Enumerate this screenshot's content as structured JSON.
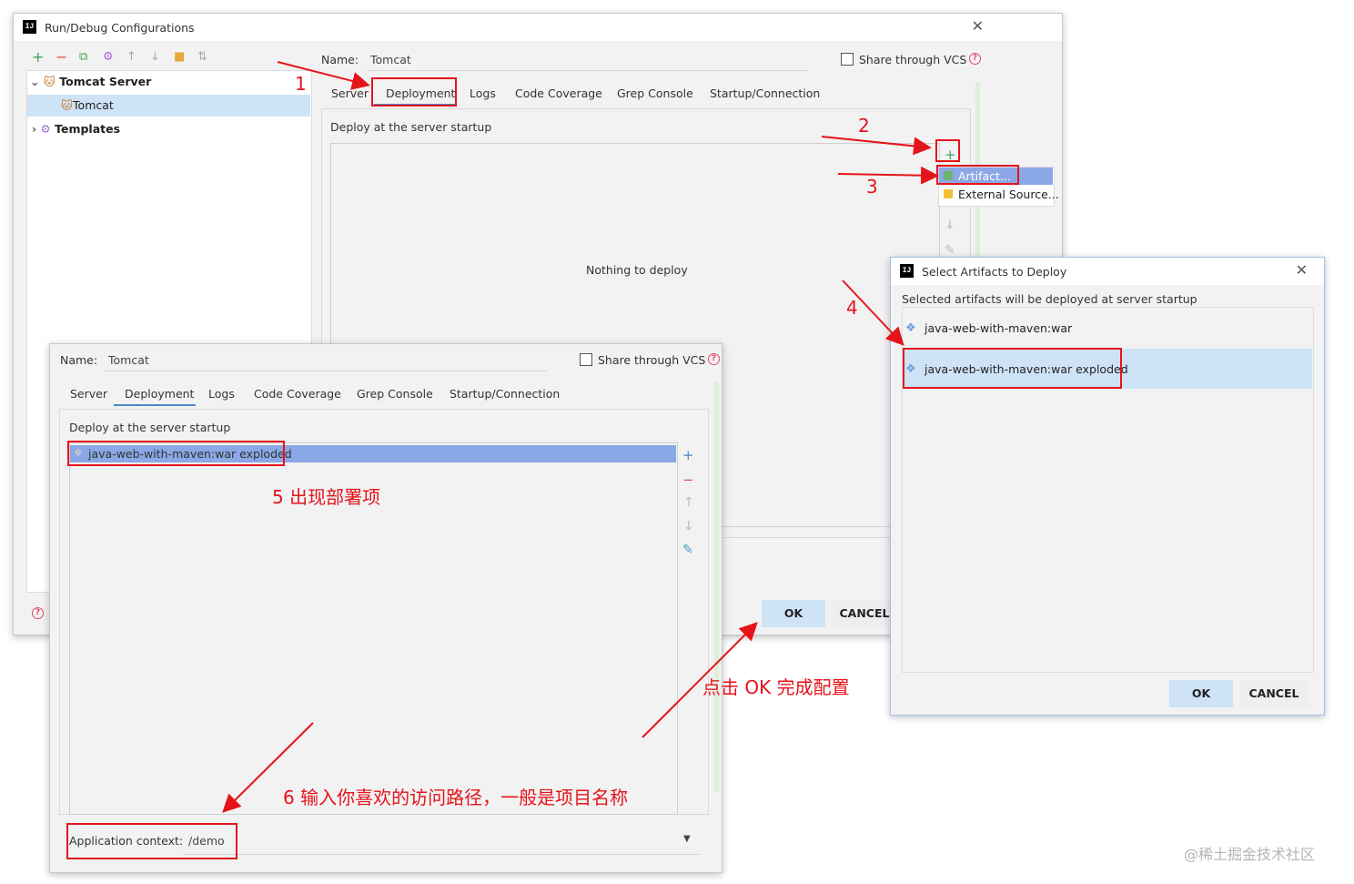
{
  "main_dialog": {
    "title": "Run/Debug Configurations",
    "name_label": "Name:",
    "name_value": "Tomcat",
    "share_vcs": "Share through VCS",
    "tree": {
      "tomcat_server": "Tomcat Server",
      "tomcat": "Tomcat",
      "templates": "Templates"
    },
    "tabs": [
      "Server",
      "Deployment",
      "Logs",
      "Code Coverage",
      "Grep Console",
      "Startup/Connection"
    ],
    "deploy_label": "Deploy at the server startup",
    "empty_text": "Nothing to deploy",
    "popup": {
      "artifact": "Artifact...",
      "external": "External Source..."
    },
    "ok": "OK",
    "cancel": "CANCEL"
  },
  "select_dialog": {
    "title": "Select Artifacts to Deploy",
    "subtitle": "Selected artifacts will be deployed at server startup",
    "items": [
      "java-web-with-maven:war",
      "java-web-with-maven:war exploded"
    ],
    "ok": "OK",
    "cancel": "CANCEL"
  },
  "front_dialog": {
    "name_label": "Name:",
    "name_value": "Tomcat",
    "share_vcs": "Share through VCS",
    "tabs": [
      "Server",
      "Deployment",
      "Logs",
      "Code Coverage",
      "Grep Console",
      "Startup/Connection"
    ],
    "deploy_label": "Deploy at the server startup",
    "deployed_item": "java-web-with-maven:war exploded",
    "app_context_label": "Application context:",
    "app_context_value": "/demo"
  },
  "annotations": {
    "n1": "1",
    "n2": "2",
    "n3": "3",
    "n4": "4",
    "step5": "5 出现部署项",
    "step_ok": "点击 OK 完成配置",
    "step6": "6 输入你喜欢的访问路径，一般是项目名称"
  },
  "watermark": "@稀土掘金技术社区",
  "colors": {
    "annotation_red": "#e5141b",
    "selection_blue": "#8aa7e6",
    "list_highlight": "#cfe3f7"
  }
}
